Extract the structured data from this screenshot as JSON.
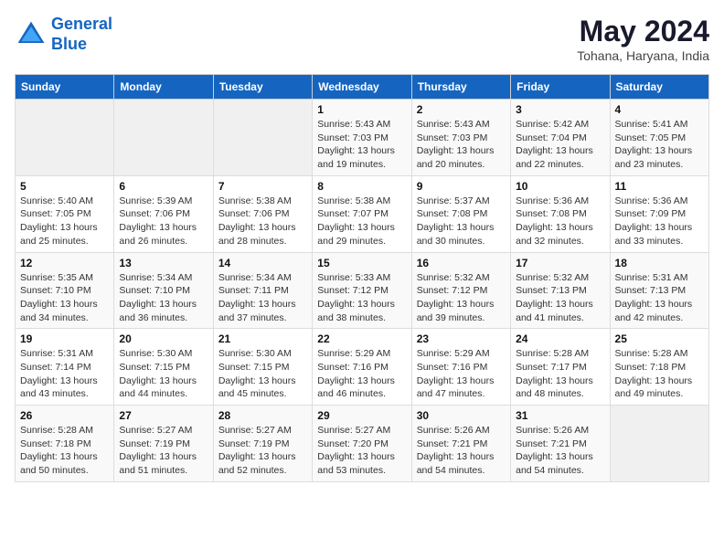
{
  "header": {
    "logo_line1": "General",
    "logo_line2": "Blue",
    "month_title": "May 2024",
    "location": "Tohana, Haryana, India"
  },
  "weekdays": [
    "Sunday",
    "Monday",
    "Tuesday",
    "Wednesday",
    "Thursday",
    "Friday",
    "Saturday"
  ],
  "weeks": [
    [
      {
        "day": "",
        "info": ""
      },
      {
        "day": "",
        "info": ""
      },
      {
        "day": "",
        "info": ""
      },
      {
        "day": "1",
        "info": "Sunrise: 5:43 AM\nSunset: 7:03 PM\nDaylight: 13 hours and 19 minutes."
      },
      {
        "day": "2",
        "info": "Sunrise: 5:43 AM\nSunset: 7:03 PM\nDaylight: 13 hours and 20 minutes."
      },
      {
        "day": "3",
        "info": "Sunrise: 5:42 AM\nSunset: 7:04 PM\nDaylight: 13 hours and 22 minutes."
      },
      {
        "day": "4",
        "info": "Sunrise: 5:41 AM\nSunset: 7:05 PM\nDaylight: 13 hours and 23 minutes."
      }
    ],
    [
      {
        "day": "5",
        "info": "Sunrise: 5:40 AM\nSunset: 7:05 PM\nDaylight: 13 hours and 25 minutes."
      },
      {
        "day": "6",
        "info": "Sunrise: 5:39 AM\nSunset: 7:06 PM\nDaylight: 13 hours and 26 minutes."
      },
      {
        "day": "7",
        "info": "Sunrise: 5:38 AM\nSunset: 7:06 PM\nDaylight: 13 hours and 28 minutes."
      },
      {
        "day": "8",
        "info": "Sunrise: 5:38 AM\nSunset: 7:07 PM\nDaylight: 13 hours and 29 minutes."
      },
      {
        "day": "9",
        "info": "Sunrise: 5:37 AM\nSunset: 7:08 PM\nDaylight: 13 hours and 30 minutes."
      },
      {
        "day": "10",
        "info": "Sunrise: 5:36 AM\nSunset: 7:08 PM\nDaylight: 13 hours and 32 minutes."
      },
      {
        "day": "11",
        "info": "Sunrise: 5:36 AM\nSunset: 7:09 PM\nDaylight: 13 hours and 33 minutes."
      }
    ],
    [
      {
        "day": "12",
        "info": "Sunrise: 5:35 AM\nSunset: 7:10 PM\nDaylight: 13 hours and 34 minutes."
      },
      {
        "day": "13",
        "info": "Sunrise: 5:34 AM\nSunset: 7:10 PM\nDaylight: 13 hours and 36 minutes."
      },
      {
        "day": "14",
        "info": "Sunrise: 5:34 AM\nSunset: 7:11 PM\nDaylight: 13 hours and 37 minutes."
      },
      {
        "day": "15",
        "info": "Sunrise: 5:33 AM\nSunset: 7:12 PM\nDaylight: 13 hours and 38 minutes."
      },
      {
        "day": "16",
        "info": "Sunrise: 5:32 AM\nSunset: 7:12 PM\nDaylight: 13 hours and 39 minutes."
      },
      {
        "day": "17",
        "info": "Sunrise: 5:32 AM\nSunset: 7:13 PM\nDaylight: 13 hours and 41 minutes."
      },
      {
        "day": "18",
        "info": "Sunrise: 5:31 AM\nSunset: 7:13 PM\nDaylight: 13 hours and 42 minutes."
      }
    ],
    [
      {
        "day": "19",
        "info": "Sunrise: 5:31 AM\nSunset: 7:14 PM\nDaylight: 13 hours and 43 minutes."
      },
      {
        "day": "20",
        "info": "Sunrise: 5:30 AM\nSunset: 7:15 PM\nDaylight: 13 hours and 44 minutes."
      },
      {
        "day": "21",
        "info": "Sunrise: 5:30 AM\nSunset: 7:15 PM\nDaylight: 13 hours and 45 minutes."
      },
      {
        "day": "22",
        "info": "Sunrise: 5:29 AM\nSunset: 7:16 PM\nDaylight: 13 hours and 46 minutes."
      },
      {
        "day": "23",
        "info": "Sunrise: 5:29 AM\nSunset: 7:16 PM\nDaylight: 13 hours and 47 minutes."
      },
      {
        "day": "24",
        "info": "Sunrise: 5:28 AM\nSunset: 7:17 PM\nDaylight: 13 hours and 48 minutes."
      },
      {
        "day": "25",
        "info": "Sunrise: 5:28 AM\nSunset: 7:18 PM\nDaylight: 13 hours and 49 minutes."
      }
    ],
    [
      {
        "day": "26",
        "info": "Sunrise: 5:28 AM\nSunset: 7:18 PM\nDaylight: 13 hours and 50 minutes."
      },
      {
        "day": "27",
        "info": "Sunrise: 5:27 AM\nSunset: 7:19 PM\nDaylight: 13 hours and 51 minutes."
      },
      {
        "day": "28",
        "info": "Sunrise: 5:27 AM\nSunset: 7:19 PM\nDaylight: 13 hours and 52 minutes."
      },
      {
        "day": "29",
        "info": "Sunrise: 5:27 AM\nSunset: 7:20 PM\nDaylight: 13 hours and 53 minutes."
      },
      {
        "day": "30",
        "info": "Sunrise: 5:26 AM\nSunset: 7:21 PM\nDaylight: 13 hours and 54 minutes."
      },
      {
        "day": "31",
        "info": "Sunrise: 5:26 AM\nSunset: 7:21 PM\nDaylight: 13 hours and 54 minutes."
      },
      {
        "day": "",
        "info": ""
      }
    ]
  ]
}
